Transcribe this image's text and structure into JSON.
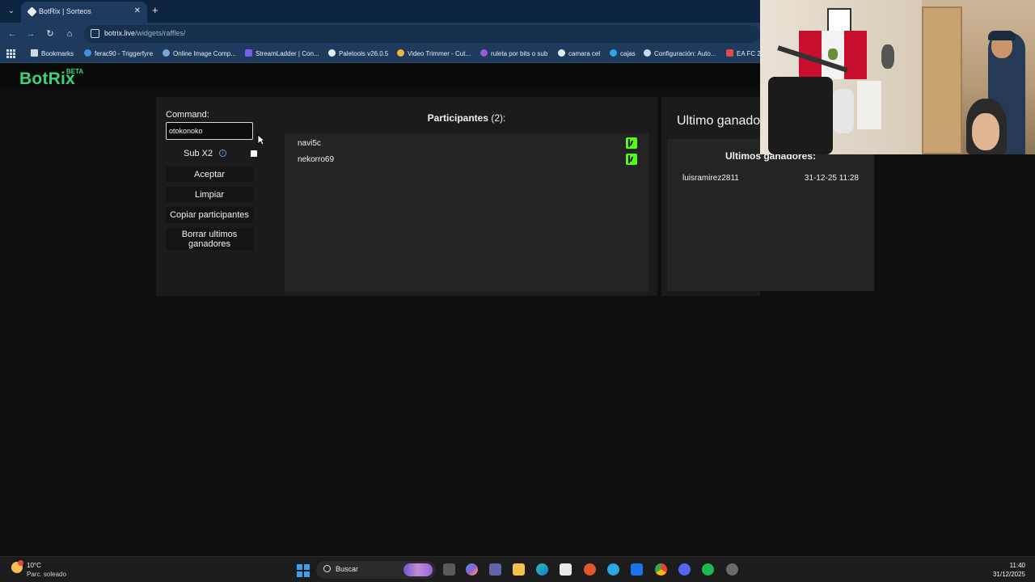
{
  "browser": {
    "tab_title": "BotRix | Sorteos",
    "new_tab_glyph": "+",
    "close_glyph": "✕",
    "url_host": "botrix.live",
    "url_path": "/widgets/raffles/",
    "bookmarks": [
      {
        "label": "Bookmarks",
        "color": "#cfd8e3"
      },
      {
        "label": "ferac90 - Triggerfyre",
        "color": "#4a90d9"
      },
      {
        "label": "Online Image Comp...",
        "color": "#7aa7d9"
      },
      {
        "label": "StreamLadder | Con...",
        "color": "#7b5cf0"
      },
      {
        "label": "Paletools v26.0.5",
        "color": "#e8eef5"
      },
      {
        "label": "Video Trimmer - Cut...",
        "color": "#f0b43a"
      },
      {
        "label": "ruleta por bits o sub",
        "color": "#9b59d6"
      },
      {
        "label": "camara cel",
        "color": "#e8eef5"
      },
      {
        "label": "cajas",
        "color": "#2aa8e0"
      },
      {
        "label": "Configuración: Auto...",
        "color": "#cfd8e3"
      },
      {
        "label": "EA FC 2",
        "color": "#e04a4a"
      }
    ]
  },
  "app": {
    "logo": "BotRix",
    "beta": "BETA",
    "accent": "#3bd47a"
  },
  "raffle": {
    "command_label": "Command:",
    "command_value": "otokonoko",
    "sub_x2_label": "Sub X2",
    "info_glyph": "i",
    "buttons": {
      "accept": "Aceptar",
      "clear": "Limpiar",
      "copy": "Copiar participantes",
      "delete_winners": "Borrar ultimos ganadores"
    },
    "participants_title": "Participantes",
    "participants_count": "(2):",
    "participants": [
      {
        "name": "navi5c"
      },
      {
        "name": "nekorro69"
      }
    ],
    "last_winner_heading": "Ultimo ganado",
    "last_winners_title": "Ultimos ganadores:",
    "winners": [
      {
        "name": "luisramirez2811",
        "date": "31-12-25 11:28"
      }
    ],
    "kick_color": "#53fc18"
  },
  "taskbar": {
    "temp": "10°C",
    "weather": "Parc. soleado",
    "search_placeholder": "Buscar",
    "time": "11:40",
    "date": "31/12/2025"
  }
}
